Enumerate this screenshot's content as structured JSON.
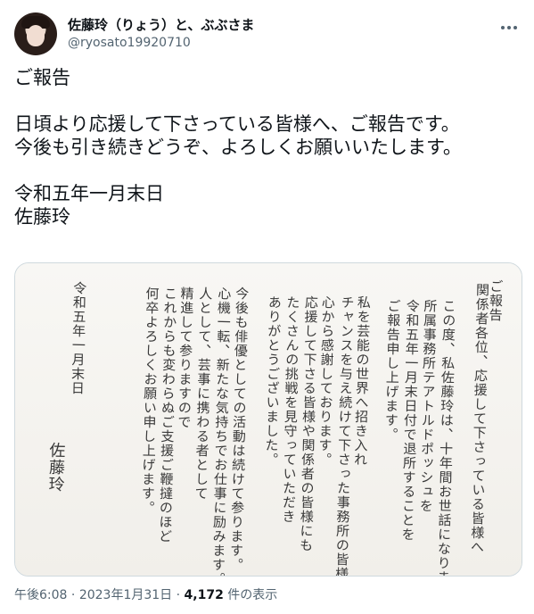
{
  "author": {
    "display_name": "佐藤玲（りょう）と、ぶぶさま",
    "handle": "@ryosato19920710"
  },
  "tweet": {
    "lines": [
      "ご報告",
      "",
      "日頃より応援して下さっている皆様へ、ご報告です。",
      "今後も引き続きどうぞ、よろしくお願いいたします。",
      "",
      "令和五年一月末日",
      "佐藤玲"
    ]
  },
  "letter": {
    "columns": [
      "ご報告",
      "関係者各位、応援して下さっている皆様へ",
      "この度、私佐藤玲は、十年間お世話になりました",
      "所属事務所テアトルドポッシュを",
      "令和五年一月末日付で退所することを",
      "ご報告申し上げます。",
      "私を芸能の世界へ招き入れ",
      "チャンスを与え続けて下さった事務所の皆様には",
      "心から感謝しております。",
      "応援して下さる皆様や関係者の皆様にも",
      "たくさんの挑戦を見守っていただき",
      "ありがとうございました。",
      "今後も俳優としての活動は続けて参ります。",
      "心機一転、新たな気持ちでお仕事に励みます。",
      "人として、芸事に携わる者として",
      "精進して参りますので",
      "これからも変わらぬご支援ご鞭撻のほど",
      "何卒よろしくお願い申し上げます。",
      "令和五年一月末日",
      "佐藤玲"
    ]
  },
  "footer": {
    "time": "午後6:08",
    "separator": "·",
    "date": "2023年1月31日",
    "views_count": "4,172",
    "views_label": "件の表示"
  },
  "colors": {
    "text": "#0f1419",
    "secondary": "#536471",
    "border": "#cfd9de"
  }
}
